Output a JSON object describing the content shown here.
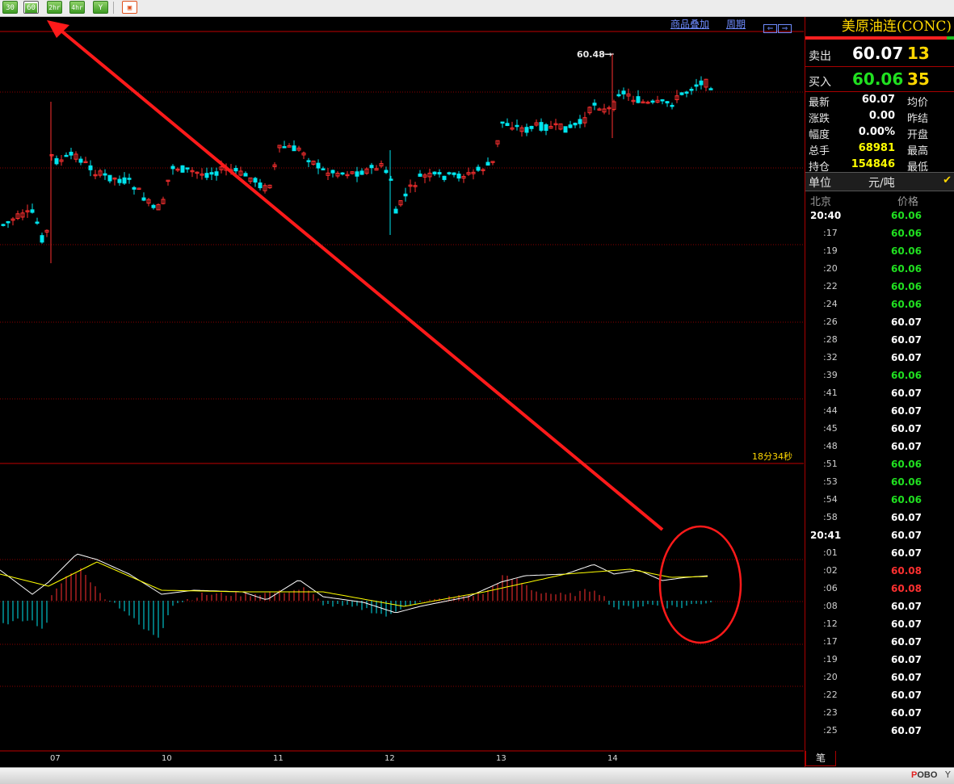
{
  "toolbar": {
    "buttons": [
      "30",
      "60",
      "2hr",
      "4hr",
      "Y"
    ],
    "selected": "60",
    "extra_icon": "chart-window-icon"
  },
  "chart": {
    "overlay_link": "商品叠加",
    "period_link": "周期",
    "peak_price_label": "60.48",
    "countdown": "18分34秒",
    "x_labels": [
      "07",
      "10",
      "11",
      "12",
      "13",
      "14"
    ],
    "colors": {
      "up": "#ff3030",
      "down": "#00e5ee",
      "dif": "#ffffff",
      "dea": "#ffff00",
      "grid": "#8b0000",
      "annotation": "#ff1a1a"
    }
  },
  "panel": {
    "title": "美原油连(CONC)",
    "sell": {
      "label": "卖出",
      "price": "60.07",
      "volume": "13"
    },
    "buy": {
      "label": "买入",
      "price": "60.06",
      "volume": "35"
    },
    "info": [
      {
        "label": "最新",
        "value": "60.07",
        "right": "均价",
        "color": "#ffffff"
      },
      {
        "label": "涨跌",
        "value": "0.00",
        "right": "昨结",
        "color": "#ffffff"
      },
      {
        "label": "幅度",
        "value": "0.00%",
        "right": "开盘",
        "color": "#ffffff"
      },
      {
        "label": "总手",
        "value": "68981",
        "right": "最高",
        "color": "#ffff00"
      },
      {
        "label": "持仓",
        "value": "154846",
        "right": "最低",
        "color": "#ffff00"
      }
    ],
    "unit": {
      "label": "单位",
      "value": "元/吨"
    },
    "tick_header": {
      "time": "北京",
      "price": "价格"
    },
    "ticks": [
      {
        "time": "20:40",
        "price": "60.06",
        "dir": "down"
      },
      {
        "time": ":17",
        "price": "60.06",
        "dir": "down"
      },
      {
        "time": ":19",
        "price": "60.06",
        "dir": "down"
      },
      {
        "time": ":20",
        "price": "60.06",
        "dir": "down"
      },
      {
        "time": ":22",
        "price": "60.06",
        "dir": "down"
      },
      {
        "time": ":24",
        "price": "60.06",
        "dir": "down"
      },
      {
        "time": ":26",
        "price": "60.07",
        "dir": "flat"
      },
      {
        "time": ":28",
        "price": "60.07",
        "dir": "flat"
      },
      {
        "time": ":32",
        "price": "60.07",
        "dir": "flat"
      },
      {
        "time": ":39",
        "price": "60.06",
        "dir": "down"
      },
      {
        "time": ":41",
        "price": "60.07",
        "dir": "flat"
      },
      {
        "time": ":44",
        "price": "60.07",
        "dir": "flat"
      },
      {
        "time": ":45",
        "price": "60.07",
        "dir": "flat"
      },
      {
        "time": ":48",
        "price": "60.07",
        "dir": "flat"
      },
      {
        "time": ":51",
        "price": "60.06",
        "dir": "down"
      },
      {
        "time": ":53",
        "price": "60.06",
        "dir": "down"
      },
      {
        "time": ":54",
        "price": "60.06",
        "dir": "down"
      },
      {
        "time": ":58",
        "price": "60.07",
        "dir": "flat"
      },
      {
        "time": "20:41",
        "price": "60.07",
        "dir": "flat"
      },
      {
        "time": ":01",
        "price": "60.07",
        "dir": "flat"
      },
      {
        "time": ":02",
        "price": "60.08",
        "dir": "up"
      },
      {
        "time": ":06",
        "price": "60.08",
        "dir": "up"
      },
      {
        "time": ":08",
        "price": "60.07",
        "dir": "flat"
      },
      {
        "time": ":12",
        "price": "60.07",
        "dir": "flat"
      },
      {
        "time": ":17",
        "price": "60.07",
        "dir": "flat"
      },
      {
        "time": ":19",
        "price": "60.07",
        "dir": "flat"
      },
      {
        "time": ":20",
        "price": "60.07",
        "dir": "flat"
      },
      {
        "time": ":22",
        "price": "60.07",
        "dir": "flat"
      },
      {
        "time": ":23",
        "price": "60.07",
        "dir": "flat"
      },
      {
        "time": ":25",
        "price": "60.07",
        "dir": "flat"
      }
    ],
    "bottom_tab": "笔"
  },
  "status": {
    "logo": "POBO"
  }
}
